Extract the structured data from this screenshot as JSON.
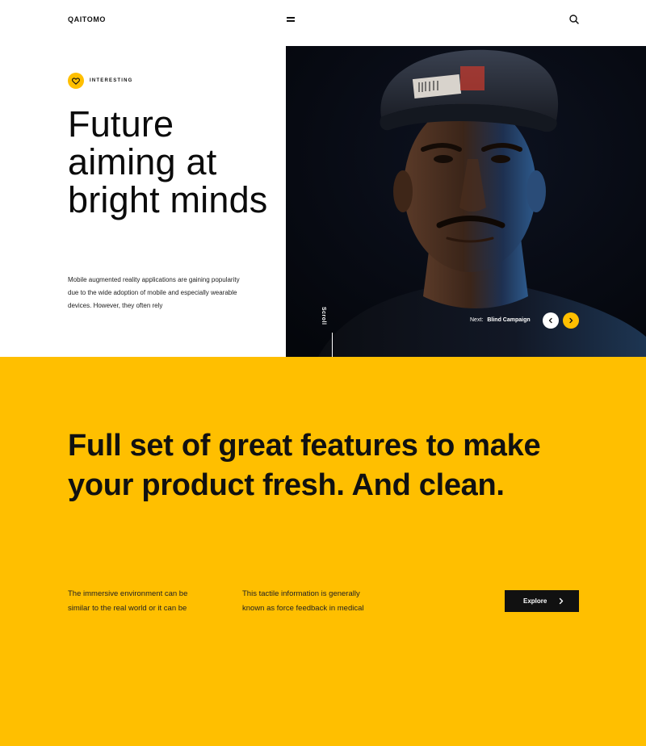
{
  "header": {
    "logo": "QAITOMO",
    "menu_icon": "hamburger-icon",
    "search_icon": "search-icon"
  },
  "hero": {
    "badge_icon": "heart-icon",
    "badge_label": "INTERESTING",
    "title": "Future aiming at bright minds",
    "description": "Mobile augmented reality applications are gaining popularity due to the wide adoption of mobile and especially wearable devices. However, they often rely",
    "scroll_label": "Scroll",
    "next_prefix": "Next:",
    "next_title": "Blind Campaign",
    "prev_icon": "chevron-left-icon",
    "next_icon": "chevron-right-icon"
  },
  "features": {
    "title": "Full set of great features to make your product fresh. And clean.",
    "col1": "The immersive environment can be similar to the real world or it can be",
    "col2": "This tactile information is generally known as force feedback in medical",
    "explore_label": "Explore"
  },
  "colors": {
    "accent": "#ffbf00",
    "dark": "#111111",
    "white": "#ffffff"
  }
}
